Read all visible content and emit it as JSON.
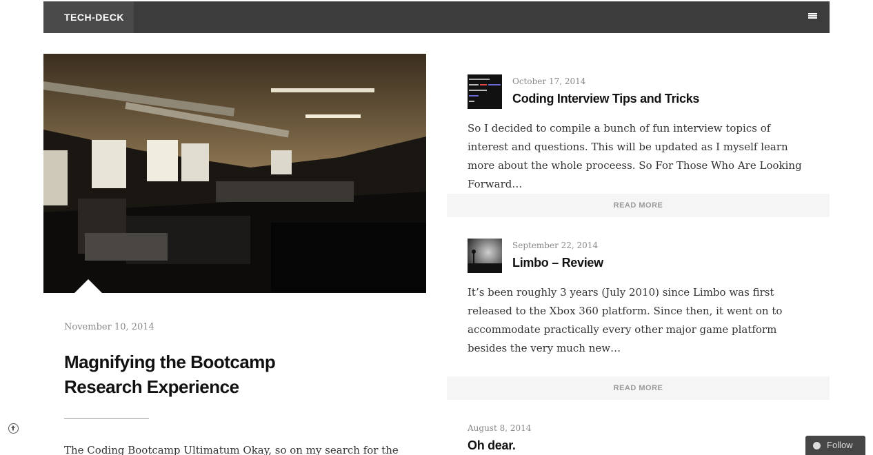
{
  "nav": {
    "brand": "TECH-DECK"
  },
  "featured": {
    "date": "November 10, 2014",
    "title": "Magnifying the Bootcamp Research Experience",
    "excerpt": "The Coding Bootcamp Ultimatum Okay, so on my search for the"
  },
  "posts": [
    {
      "date": "October 17, 2014",
      "title": "Coding Interview Tips and Tricks",
      "excerpt": "So I decided to compile a bunch of fun interview topics of interest and questions. This will be updated as I myself learn more about the whole proceess. So For Those Who Are Looking Forward…",
      "read_more": "READ MORE"
    },
    {
      "date": "September 22, 2014",
      "title": "Limbo – Review",
      "excerpt": "It’s been roughly 3 years (July 2010) since Limbo was first released to the Xbox 360 platform. Since then, it went on to accommodate practically every other major game platform besides the very much new…",
      "read_more": "READ MORE"
    },
    {
      "date": "August 8, 2014",
      "title": "Oh dear."
    }
  ],
  "follow": {
    "label": "Follow"
  },
  "colors": {
    "navbar": "#3c3c3c",
    "brand_bg": "#4a4a4a",
    "read_more_bg": "#f5f5f5"
  }
}
